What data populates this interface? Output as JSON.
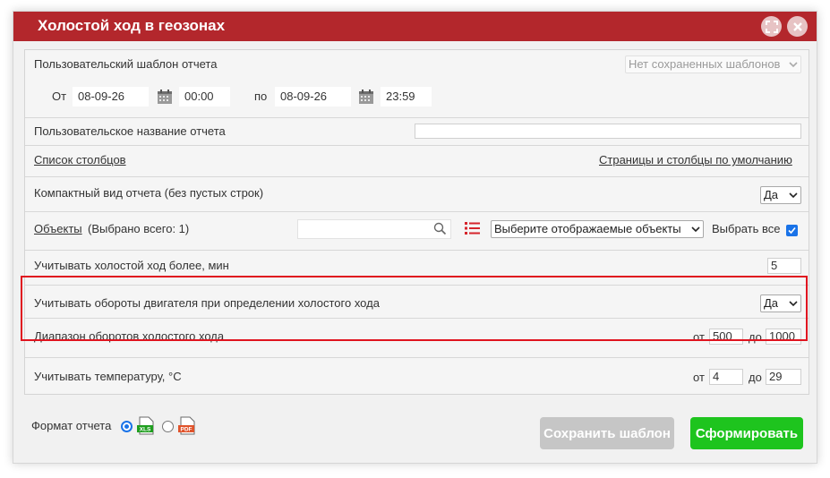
{
  "dialog": {
    "title": "Холостой ход в геозонах"
  },
  "template": {
    "label": "Пользовательский шаблон отчета",
    "select_value": "Нет сохраненных шаблонов"
  },
  "period": {
    "from_label": "От",
    "from_date": "08-09-26",
    "from_time": "00:00",
    "to_label": "по",
    "to_date": "08-09-26",
    "to_time": "23:59"
  },
  "report_name": {
    "label": "Пользовательское название отчета",
    "value": ""
  },
  "columns": {
    "list_link": "Список столбцов",
    "defaults_link": "Страницы и столбцы по умолчанию"
  },
  "compact": {
    "label": "Компактный вид отчета (без пустых строк)",
    "value": "Да"
  },
  "objects": {
    "link": "Объекты",
    "selected": "(Выбрано всего: 1)",
    "search_value": "",
    "select_value": "Выберите отображаемые объекты",
    "select_all_label": "Выбрать все",
    "select_all_checked": true
  },
  "idle_more": {
    "label": "Учитывать холостой ход более, мин",
    "value": "5"
  },
  "engine_rpm": {
    "label": "Учитывать обороты двигателя при определении холостого хода",
    "value": "Да"
  },
  "rpm_range": {
    "label": "Диапазон оборотов холостого хода",
    "from_label": "от",
    "from_value": "500",
    "to_label": "до",
    "to_value": "1000"
  },
  "temperature": {
    "label": "Учитывать температуру, °С",
    "from_label": "от",
    "from_value": "4",
    "to_label": "до",
    "to_value": "29"
  },
  "format": {
    "label": "Формат отчета",
    "options": [
      {
        "name": "XLS",
        "checked": true,
        "color": "#1e9e1e"
      },
      {
        "name": "PDF",
        "checked": false,
        "color": "#e0532b"
      }
    ]
  },
  "buttons": {
    "save_template": "Сохранить шаблон",
    "generate": "Сформировать"
  },
  "colors": {
    "title_bar": "#b3272c",
    "generate": "#1ec41e",
    "save_disabled": "#c6c6c6",
    "highlight": "#e0141f"
  }
}
